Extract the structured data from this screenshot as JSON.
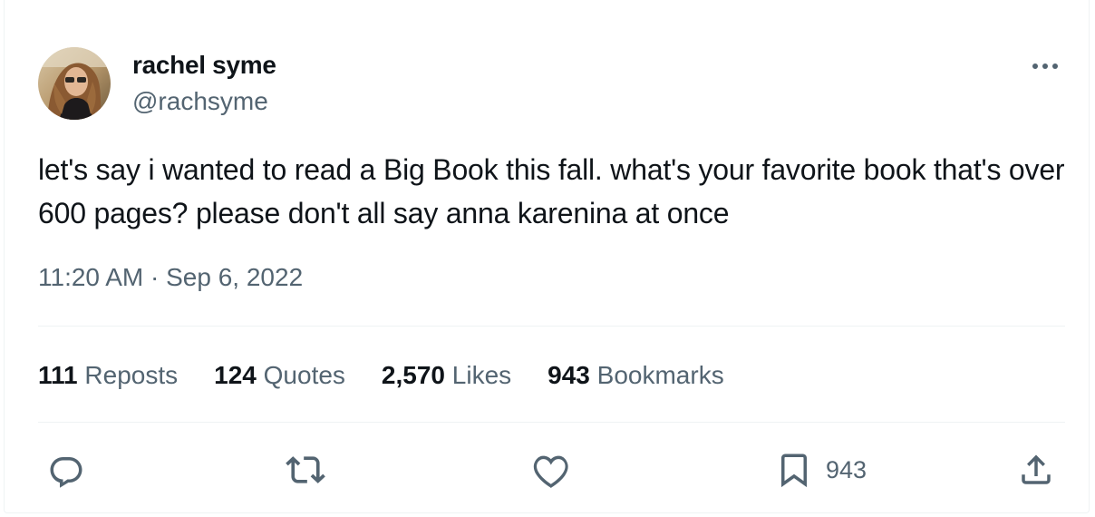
{
  "author": {
    "name": "rachel syme",
    "handle": "@rachsyme"
  },
  "tweet": {
    "text": "let's say i wanted to read a Big Book this fall. what's your favorite book that's over 600 pages? please don't all say anna karenina at once",
    "time": "11:20 AM",
    "separator": "·",
    "date": "Sep 6, 2022"
  },
  "stats": {
    "reposts": {
      "count": "111",
      "label": "Reposts"
    },
    "quotes": {
      "count": "124",
      "label": "Quotes"
    },
    "likes": {
      "count": "2,570",
      "label": "Likes"
    },
    "bookmarks": {
      "count": "943",
      "label": "Bookmarks"
    }
  },
  "actions": {
    "reply_icon": "reply-icon",
    "repost_icon": "repost-icon",
    "like_icon": "heart-icon",
    "bookmark_icon": "bookmark-icon",
    "bookmark_count": "943",
    "share_icon": "share-icon"
  },
  "colors": {
    "primary_text": "#0f1419",
    "secondary_text": "#536471",
    "divider": "#eff3f4"
  }
}
